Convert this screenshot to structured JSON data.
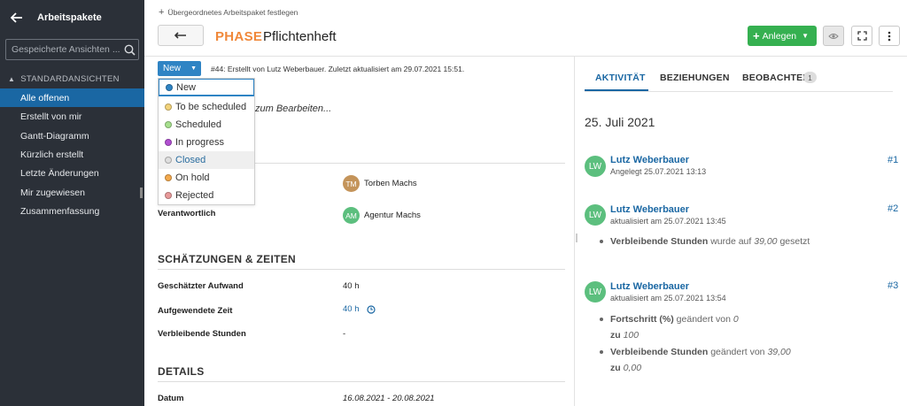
{
  "sidebar": {
    "title": "Arbeitspakete",
    "search_placeholder": "Gespeicherte Ansichten ...",
    "section_label": "STANDARDANSICHTEN",
    "items": [
      {
        "label": "Alle offenen"
      },
      {
        "label": "Erstellt von mir"
      },
      {
        "label": "Gantt-Diagramm"
      },
      {
        "label": "Kürzlich erstellt"
      },
      {
        "label": "Letzte Änderungen"
      },
      {
        "label": "Mir zugewiesen"
      },
      {
        "label": "Zusammenfassung"
      }
    ]
  },
  "header": {
    "parent_link": "Übergeordnetes Arbeitspaket festlegen",
    "type": "PHASE",
    "subject": "Pflichtenheft",
    "create_button": "Anlegen"
  },
  "status": {
    "current": "New",
    "created_info": "#44: Erstellt von Lutz Weberbauer. Zuletzt aktualisiert am 29.07.2021 15:51.",
    "options": [
      {
        "label": "New",
        "color": "#2f84c4"
      },
      {
        "label": "To be scheduled",
        "color": "#f2d27a"
      },
      {
        "label": "Scheduled",
        "color": "#a7e08e"
      },
      {
        "label": "In progress",
        "color": "#b14fd1"
      },
      {
        "label": "Closed",
        "color": "#dedede"
      },
      {
        "label": "On hold",
        "color": "#f3a94d"
      },
      {
        "label": "Rejected",
        "color": "#e89a9a"
      }
    ]
  },
  "description_placeholder": "zum Bearbeiten...",
  "people": {
    "assignee": {
      "initials": "TM",
      "name": "Torben Machs",
      "color": "#c4945a"
    },
    "responsible_label": "Verantwortlich",
    "responsible": {
      "initials": "AM",
      "name": "Agentur Machs",
      "color": "#5cbf7e"
    }
  },
  "estimates": {
    "title": "SCHÄTZUNGEN & ZEITEN",
    "fields": [
      {
        "label": "Geschätzter Aufwand",
        "value": "40 h"
      },
      {
        "label": "Aufgewendete Zeit",
        "value": "40 h"
      },
      {
        "label": "Verbleibende Stunden",
        "value": "-"
      }
    ]
  },
  "details": {
    "title": "DETAILS",
    "date_label": "Datum",
    "date_value": "16.08.2021 - 20.08.2021"
  },
  "tabs": {
    "activity": "AKTIVITÄT",
    "relations": "BEZIEHUNGEN",
    "watchers": "BEOBACHTER",
    "watchers_count": "1"
  },
  "activity": {
    "date": "25. Juli 2021",
    "entries": [
      {
        "initials": "LW",
        "user": "Lutz Weberbauer",
        "meta": "Angelegt 25.07.2021 13:13",
        "num": "#1"
      },
      {
        "initials": "LW",
        "user": "Lutz Weberbauer",
        "meta": "aktualisiert am 25.07.2021 13:45",
        "num": "#2",
        "change": {
          "field": "Verbleibende Stunden",
          "text": "wurde auf",
          "value": "39,00",
          "suffix": "gesetzt"
        }
      },
      {
        "initials": "LW",
        "user": "Lutz Weberbauer",
        "meta": "aktualisiert am 25.07.2021 13:54",
        "num": "#3",
        "changes": [
          {
            "field": "Fortschritt (%)",
            "text": "geändert von",
            "from": "0",
            "to_label": "zu",
            "to": "100"
          },
          {
            "field": "Verbleibende Stunden",
            "text": "geändert von",
            "from": "39,00",
            "to_label": "zu",
            "to": "0,00"
          }
        ]
      }
    ]
  }
}
